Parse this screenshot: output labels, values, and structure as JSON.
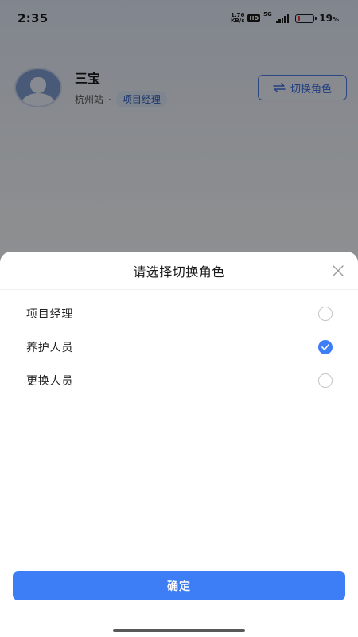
{
  "status_bar": {
    "time": "2:35",
    "net_speed_value": "1.76",
    "net_speed_unit": "KB/s",
    "hd_badge": "HD",
    "network_gen": "5G",
    "battery_percent": "19",
    "battery_unit": "%",
    "battery_level": 0.19,
    "battery_color": "#e53935"
  },
  "profile": {
    "name": "三宝",
    "station": "杭州站",
    "separator": "·",
    "current_role": "项目经理",
    "switch_button_label": "切换角色"
  },
  "sheet": {
    "title": "请选择切换角色",
    "options": [
      {
        "label": "项目经理",
        "selected": false
      },
      {
        "label": "养护人员",
        "selected": true
      },
      {
        "label": "更换人员",
        "selected": false
      }
    ],
    "confirm_label": "确定"
  },
  "colors": {
    "accent": "#3d7df5",
    "overlay": "rgba(0,0,0,0.42)"
  }
}
